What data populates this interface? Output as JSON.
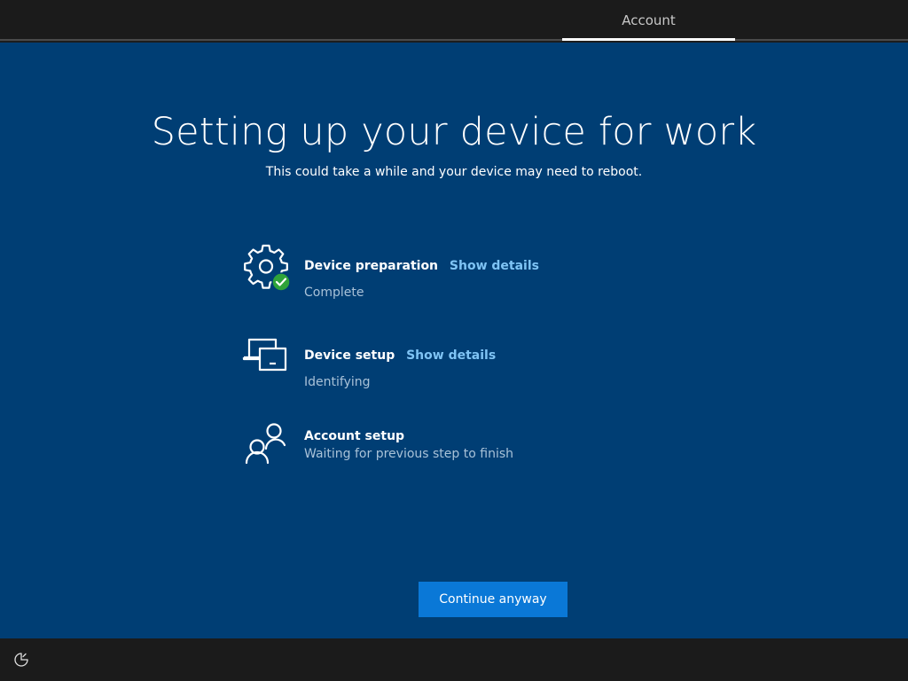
{
  "header": {
    "tabs": [
      {
        "label": "Account",
        "active": true
      }
    ]
  },
  "main": {
    "title": "Setting up your device for work",
    "subtitle": "This could take a while and your device may need to reboot.",
    "steps": [
      {
        "icon": "gear-check-icon",
        "title": "Device preparation",
        "details_label": "Show details",
        "status": "Complete"
      },
      {
        "icon": "devices-icon",
        "title": "Device setup",
        "details_label": "Show details",
        "status": "Identifying"
      },
      {
        "icon": "people-icon",
        "title": "Account setup",
        "status": "Waiting for previous step to finish"
      }
    ],
    "continue_label": "Continue anyway"
  },
  "footer": {
    "icon": "ease-of-access-icon"
  },
  "colors": {
    "background": "#003e74",
    "topbar": "#1b1b1b",
    "accent_button": "#0a78d7",
    "link": "#7fc4f5",
    "status_text": "#a9c2d8",
    "check_green": "#2fa33a"
  }
}
